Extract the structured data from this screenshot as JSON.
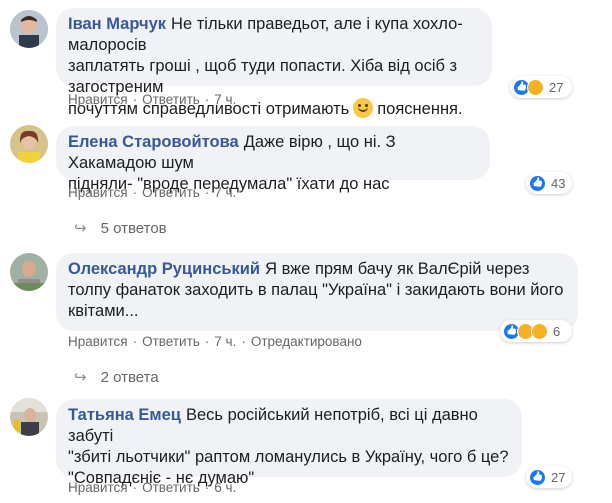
{
  "comments": [
    {
      "author": "Іван Марчук",
      "lines": [
        "Не тільки праведьот, але і купа хохло-малоросів",
        "заплатять гроші , щоб туди попасти. Хіба від осіб з загостреним",
        "почуттям справедливості отримають"
      ],
      "line3_tail": "пояснення.",
      "reactions": {
        "icons": [
          "like",
          "sad"
        ],
        "count": "27"
      },
      "actions": {
        "like": "Нравится",
        "reply": "Ответить",
        "time": "7 ч."
      }
    },
    {
      "author": "Елена Старовойтова",
      "lines": [
        "Даже вірю , що ні. З Хакамадою шум",
        "підняли- \"вроде передумала\" їхати до нас"
      ],
      "reactions": {
        "icons": [
          "like"
        ],
        "count": "43"
      },
      "actions": {
        "like": "Нравится",
        "reply": "Ответить",
        "time": "7 ч."
      },
      "replies": "5 ответов"
    },
    {
      "author": "Олександр Руцинський",
      "lines": [
        "Я вже прям бачу як ВалЄрій через",
        "толпу фанаток заходить в палац \"Україна\" і закидають вони його",
        "квітами..."
      ],
      "reactions": {
        "icons": [
          "like",
          "sad",
          "wow"
        ],
        "count": "6"
      },
      "actions": {
        "like": "Нравится",
        "reply": "Ответить",
        "time": "7 ч.",
        "edited": "Отредактировано"
      },
      "replies": "2 ответа"
    },
    {
      "author": "Татьяна Емец",
      "lines": [
        "Весь російський непотріб, всі ці давно забуті",
        "\"збиті льотчики\" раптом ломанулись в Україну, чого б це?",
        "\"Совпадєніє - нє думаю\""
      ],
      "reactions": {
        "icons": [
          "like"
        ],
        "count": "27"
      },
      "actions": {
        "like": "Нравится",
        "reply": "Ответить",
        "time": "6 ч."
      }
    }
  ],
  "colors": {
    "author": "#385898",
    "bubble": "#f0f2f5",
    "meta": "#65676b",
    "like": "#1877f2",
    "sad": "#f7b125"
  }
}
